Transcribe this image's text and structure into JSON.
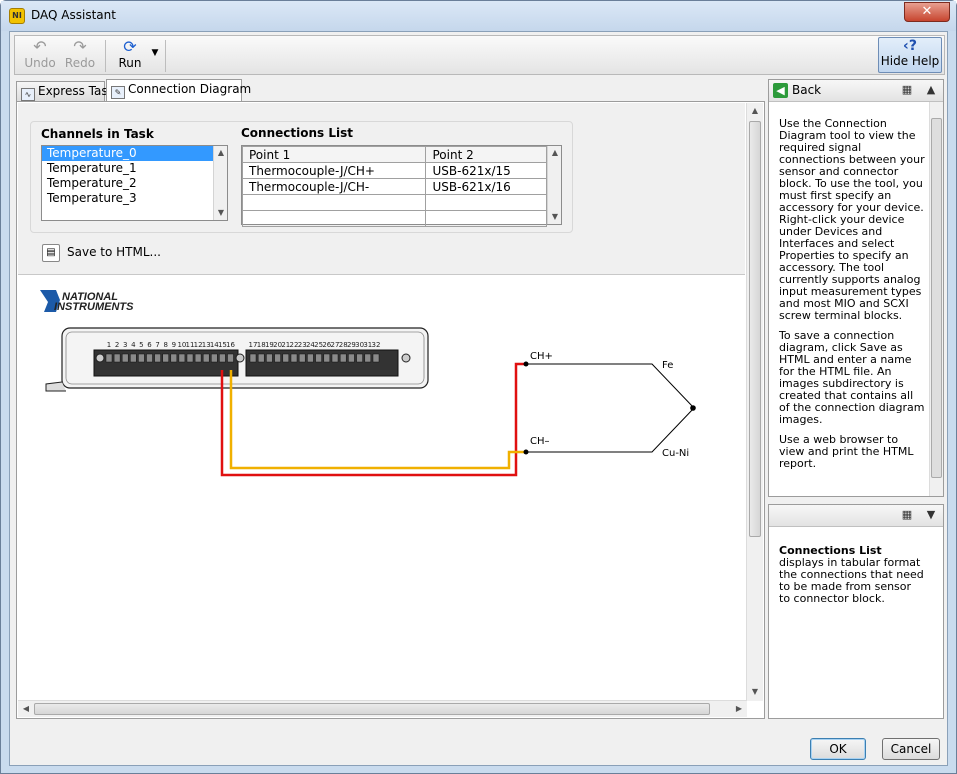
{
  "window": {
    "title": "DAQ Assistant",
    "close_symbol": "✕"
  },
  "toolbar": {
    "undo_label": "Undo",
    "redo_label": "Redo",
    "run_label": "Run",
    "hide_help_label": "Hide Help"
  },
  "tabs": [
    {
      "label": "Express Task"
    },
    {
      "label": "Connection Diagram"
    }
  ],
  "channels": {
    "caption": "Channels in Task",
    "items": [
      "Temperature_0",
      "Temperature_1",
      "Temperature_2",
      "Temperature_3"
    ],
    "selected": "Temperature_0"
  },
  "connections": {
    "caption": "Connections List",
    "columns": [
      "Point 1",
      "Point 2"
    ],
    "rows": [
      [
        "Thermocouple-J/CH+",
        "USB-621x/15"
      ],
      [
        "Thermocouple-J/CH-",
        "USB-621x/16"
      ],
      [
        "",
        ""
      ],
      [
        "",
        ""
      ]
    ]
  },
  "save_html_label": "Save to HTML...",
  "diagram": {
    "logo_line1": "NATIONAL",
    "logo_line2": "INSTRUMENTS",
    "pin_labels_left": [
      "1",
      "2",
      "3",
      "4",
      "5",
      "6",
      "7",
      "8",
      "9",
      "10",
      "11",
      "12",
      "13",
      "14",
      "15",
      "16"
    ],
    "pin_labels_right": [
      "17",
      "18",
      "19",
      "20",
      "21",
      "22",
      "23",
      "24",
      "25",
      "26",
      "27",
      "28",
      "29",
      "30",
      "31",
      "32"
    ],
    "ch_plus": "CH+",
    "ch_minus": "CH–",
    "fe_label": "Fe",
    "cuni_label": "Cu-Ni",
    "wire_red": "#e01010",
    "wire_yellow": "#f0b000"
  },
  "help": {
    "back_label": "Back",
    "para1": "Use the Connection Diagram tool to view the required signal connections between your sensor and connector block. To use the tool, you must first specify an accessory for your device. Right-click your device under Devices and Interfaces and select Properties to specify an accessory. The tool currently supports analog input measurement types and most MIO and SCXI screw terminal blocks.",
    "para2": "To save a connection diagram, click Save as HTML and enter a name for the HTML file. An images subdirectory is created that contains all of the connection diagram images.",
    "para3": "Use a web browser to view and print the HTML report."
  },
  "context_help": {
    "title": "Connections List",
    "text": "displays in tabular format the connections that need to be made from sensor to connector block."
  },
  "buttons": {
    "ok": "OK",
    "cancel": "Cancel"
  }
}
